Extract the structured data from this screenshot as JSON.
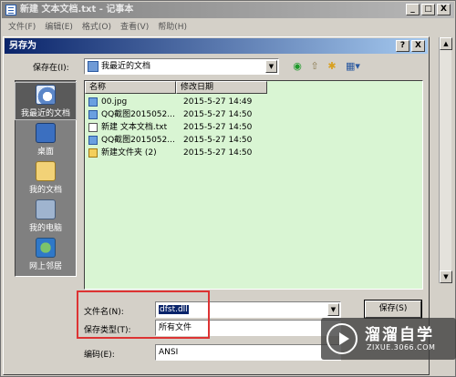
{
  "notepad": {
    "title": "新建 文本文档.txt - 记事本",
    "menus": [
      "文件(F)",
      "编辑(E)",
      "格式(O)",
      "查看(V)",
      "帮助(H)"
    ],
    "win_buttons": [
      "_",
      "□",
      "X"
    ]
  },
  "dialog": {
    "title": "另存为",
    "title_buttons": [
      "?",
      "X"
    ],
    "save_in_label": "保存在(I):",
    "save_in_value": "我最近的文档",
    "places": [
      {
        "label": "我最近的文档",
        "icon": "recent-docs-icon"
      },
      {
        "label": "桌面",
        "icon": "desktop-icon"
      },
      {
        "label": "我的文档",
        "icon": "my-documents-icon"
      },
      {
        "label": "我的电脑",
        "icon": "my-computer-icon"
      },
      {
        "label": "网上邻居",
        "icon": "network-icon"
      }
    ],
    "columns": {
      "name": "名称",
      "modified": "修改日期"
    },
    "files": [
      {
        "name": "00.jpg",
        "date": "2015-5-27 14:49",
        "icon": "image-file-icon"
      },
      {
        "name": "QQ截图2015052...",
        "date": "2015-5-27 14:50",
        "icon": "image-file-icon"
      },
      {
        "name": "新建 文本文档.txt",
        "date": "2015-5-27 14:50",
        "icon": "text-file-icon"
      },
      {
        "name": "QQ截图2015052...",
        "date": "2015-5-27 14:50",
        "icon": "image-file-icon"
      },
      {
        "name": "新建文件夹 (2)",
        "date": "2015-5-27 14:50",
        "icon": "folder-icon"
      }
    ],
    "filename_label": "文件名(N):",
    "filename_value": "dfst.dll",
    "filetype_label": "保存类型(T):",
    "filetype_value": "所有文件",
    "encoding_label": "编码(E):",
    "encoding_value": "ANSI",
    "save_button": "保存(S)",
    "highlight_color": "#dd3333"
  },
  "watermark": {
    "name": "溜溜自学",
    "url": "ZIXUE.3066.COM"
  }
}
